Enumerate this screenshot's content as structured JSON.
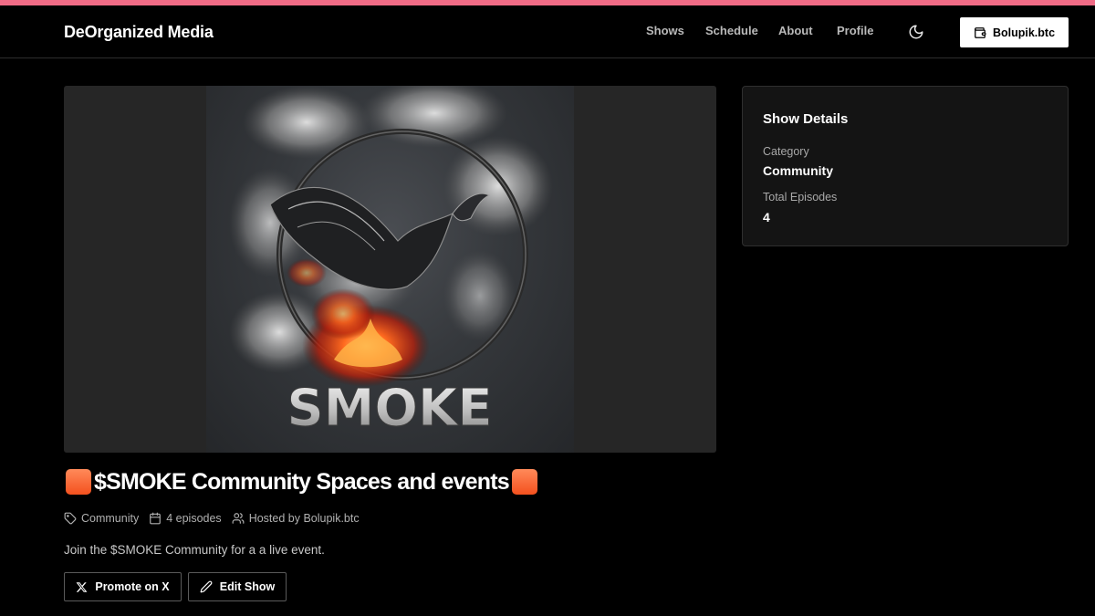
{
  "header": {
    "brand": "DeOrganized Media",
    "nav": [
      "Shows",
      "Schedule",
      "About",
      "Profile"
    ],
    "theme_icon": "moon-icon",
    "wallet_label": "Bolupik.btc",
    "wallet_icon": "wallet-icon"
  },
  "hero": {
    "art_text": "SMOKE"
  },
  "show": {
    "title_text": "$SMOKE Community Spaces and events",
    "title_emoji": "orange-square",
    "category": "Community",
    "episodes_text": "4 episodes",
    "host_text": "Hosted by Bolupik.btc",
    "description": "Join the $SMOKE Community for a a live event.",
    "actions": {
      "promote_label": "Promote on X",
      "edit_label": "Edit Show"
    }
  },
  "details": {
    "title": "Show Details",
    "category_label": "Category",
    "category_value": "Community",
    "episodes_label": "Total Episodes",
    "episodes_value": "4"
  },
  "colors": {
    "accent_bar": "#f06b86",
    "background": "#000000",
    "card": "#141414",
    "flame": "#ff5a1f"
  }
}
